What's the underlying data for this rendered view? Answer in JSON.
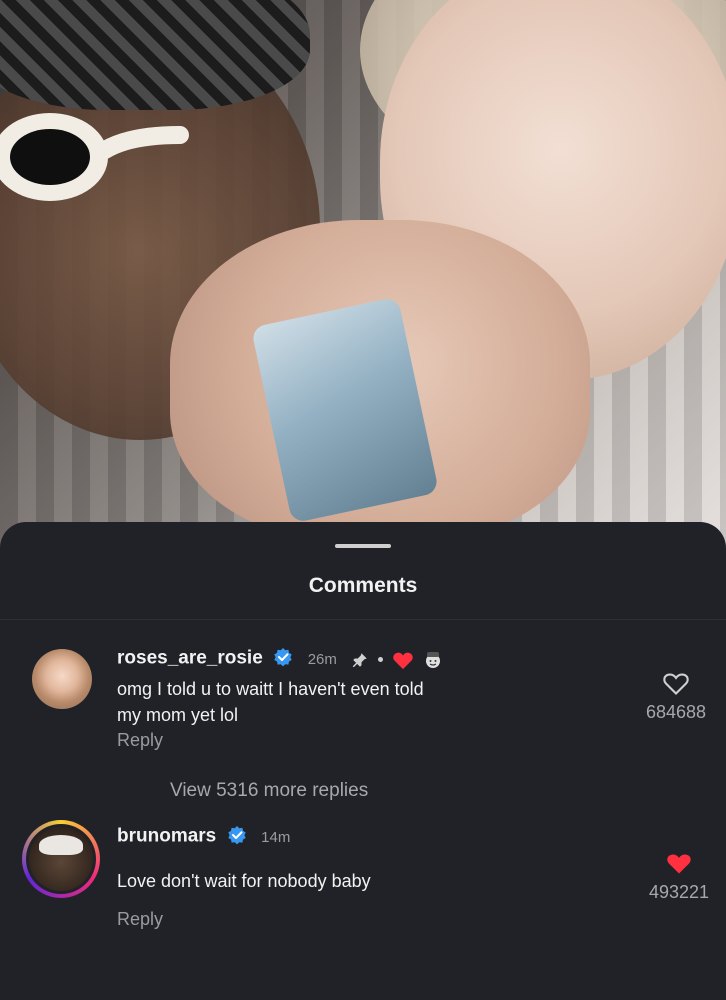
{
  "sheet": {
    "title": "Comments",
    "view_more": "View 5316 more replies"
  },
  "comments": [
    {
      "username": "roses_are_rosie",
      "time": "26m",
      "text_line1": "omg I told u to waitt I haven't even told",
      "text_line2": "my mom yet lol",
      "reply_label": "Reply",
      "likes": "684688",
      "liked": false
    },
    {
      "username": "brunomars",
      "time": "14m",
      "text": "Love don't wait for nobody baby",
      "reply_label": "Reply",
      "likes": "493221",
      "liked": true
    }
  ],
  "colors": {
    "sheet_bg": "#212227",
    "verified_blue": "#3897f0",
    "like_red": "#ff3040"
  },
  "icons": [
    "verified-badge-icon",
    "pin-icon",
    "heart-icon",
    "emoji-icon"
  ]
}
